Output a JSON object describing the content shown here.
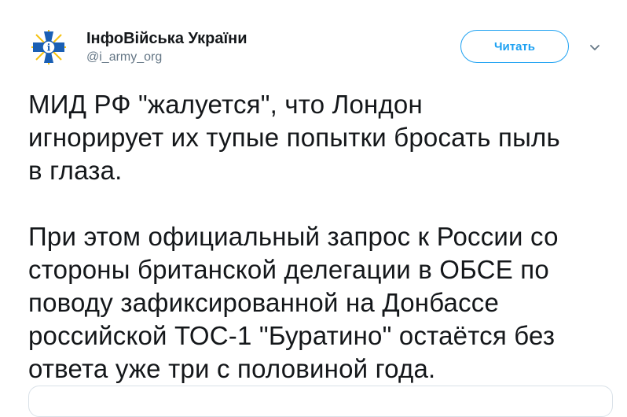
{
  "author": {
    "display_name": "ІнфоВійська України",
    "screen_name": "@i_army_org",
    "avatar_icon": "emblem-avatar-icon"
  },
  "actions": {
    "follow_label": "Читать",
    "menu_icon": "chevron-down-icon"
  },
  "tweet": {
    "paragraph1_lines": [
      "МИД РФ \"жалуется\", что Лондон",
      "игнорирует их тупые попытки бросать пыль",
      "в глаза."
    ],
    "paragraph2_lines": [
      "При этом официальный запрос к России со",
      "стороны британской делегации в ОБСЕ по",
      "поводу зафиксированной на Донбассе",
      "российской ТОС-1 \"Буратино\" остаётся без",
      "ответа уже три с половиной года."
    ]
  },
  "colors": {
    "accent": "#1da1f2",
    "text": "#14171a",
    "secondary": "#657786",
    "emblem_blue": "#1a5fb4",
    "emblem_gold": "#f5c211"
  }
}
